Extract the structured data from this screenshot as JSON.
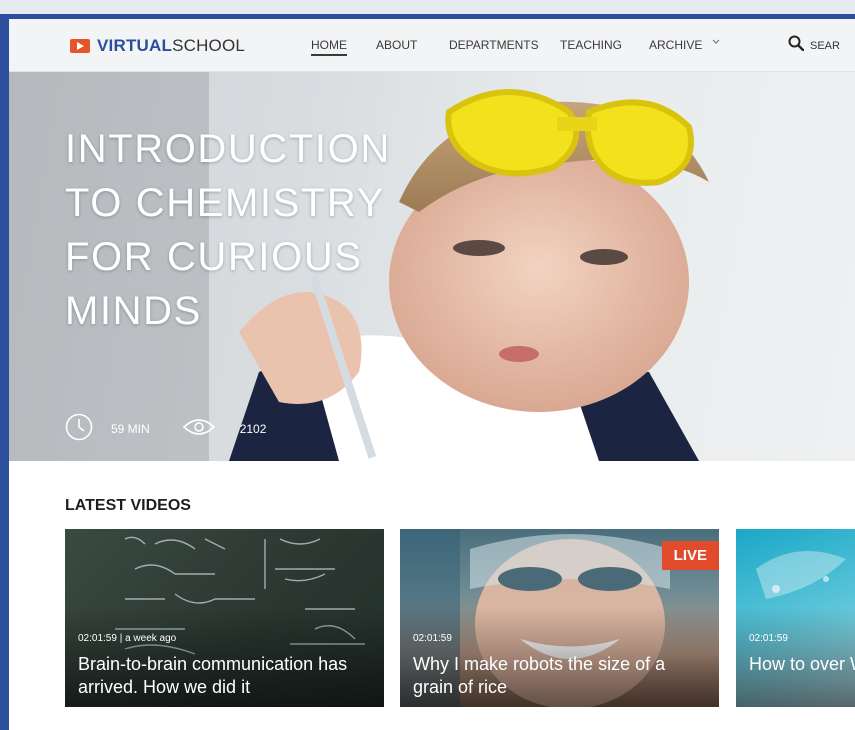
{
  "nav": {
    "logo_bold": "VIRTUAL",
    "logo_light": "SCHOOL",
    "items": [
      {
        "label": "HOME"
      },
      {
        "label": "ABOUT"
      },
      {
        "label": "DEPARTMENTS"
      },
      {
        "label": "TEACHING"
      },
      {
        "label": "ARCHIVE"
      }
    ],
    "search_label": "SEAR"
  },
  "hero": {
    "title": "INTRODUCTION TO CHEMISTRY FOR CURIOUS MINDS",
    "duration": "59 MIN",
    "views": "2102"
  },
  "latest": {
    "title": "LATEST VIDEOS",
    "cards": [
      {
        "meta": "02:01:59 | a week ago",
        "title": "Brain-to-brain communication has arrived. How we did it",
        "badge": ""
      },
      {
        "meta": "02:01:59",
        "title": "Why I make robots the size of a grain of rice",
        "badge": "LIVE"
      },
      {
        "meta": "02:01:59",
        "title": "How to over Walk boldly",
        "badge": ""
      }
    ]
  },
  "colors": {
    "brand": "#2b4f9c",
    "accent": "#e8542a",
    "live": "#e14a2a"
  },
  "icons": {
    "logo": "play-icon",
    "archive": "chevron-down-icon",
    "search": "search-icon",
    "duration": "clock-icon",
    "views": "eye-icon"
  }
}
